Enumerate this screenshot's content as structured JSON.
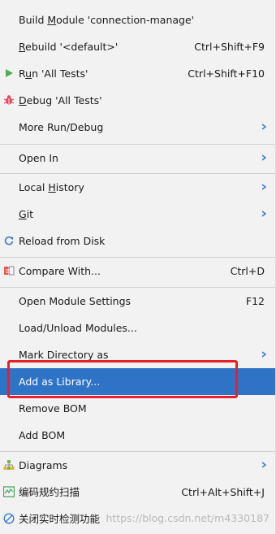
{
  "menu": {
    "items": [
      {
        "label_pre": "Build ",
        "label_u": "M",
        "label_post": "odule 'connection-manage'",
        "shortcut": ""
      },
      {
        "label_pre": "",
        "label_u": "R",
        "label_post": "ebuild '<default>'",
        "shortcut": "Ctrl+Shift+F9"
      },
      {
        "label_pre": "R",
        "label_u": "u",
        "label_post": "n 'All Tests'",
        "shortcut": "Ctrl+Shift+F10"
      },
      {
        "label_pre": "",
        "label_u": "D",
        "label_post": "ebug 'All Tests'",
        "shortcut": ""
      },
      {
        "label": "More Run/Debug"
      },
      {
        "label": "Open In"
      },
      {
        "label_pre": "Local ",
        "label_u": "H",
        "label_post": "istory"
      },
      {
        "label_pre": "",
        "label_u": "G",
        "label_post": "it"
      },
      {
        "label": "Reload from Disk"
      },
      {
        "label": "Compare With...",
        "shortcut": "Ctrl+D"
      },
      {
        "label": "Open Module Settings",
        "shortcut": "F12"
      },
      {
        "label": "Load/Unload Modules..."
      },
      {
        "label": "Mark Directory as"
      },
      {
        "label": "Add as Library..."
      },
      {
        "label": "Remove BOM"
      },
      {
        "label": "Add BOM"
      },
      {
        "label": "Diagrams"
      },
      {
        "label": "编码规约扫描",
        "shortcut": "Ctrl+Alt+Shift+J"
      },
      {
        "label": "关闭实时检测功能"
      }
    ]
  },
  "watermark": "https://blog.csdn.net/m4330187",
  "icons": {
    "run": "run-triangle-icon",
    "debug": "bug-icon",
    "reload": "refresh-icon",
    "compare": "compare-icon",
    "diagrams": "diagram-icon",
    "scan": "scan-chart-icon",
    "close_detect": "no-entry-icon",
    "submenu": "chevron-right-icon"
  },
  "colors": {
    "selection": "#2f73c7",
    "highlight_box": "#e8202a",
    "run_green": "#4caf50",
    "debug_red": "#e24a5e"
  }
}
